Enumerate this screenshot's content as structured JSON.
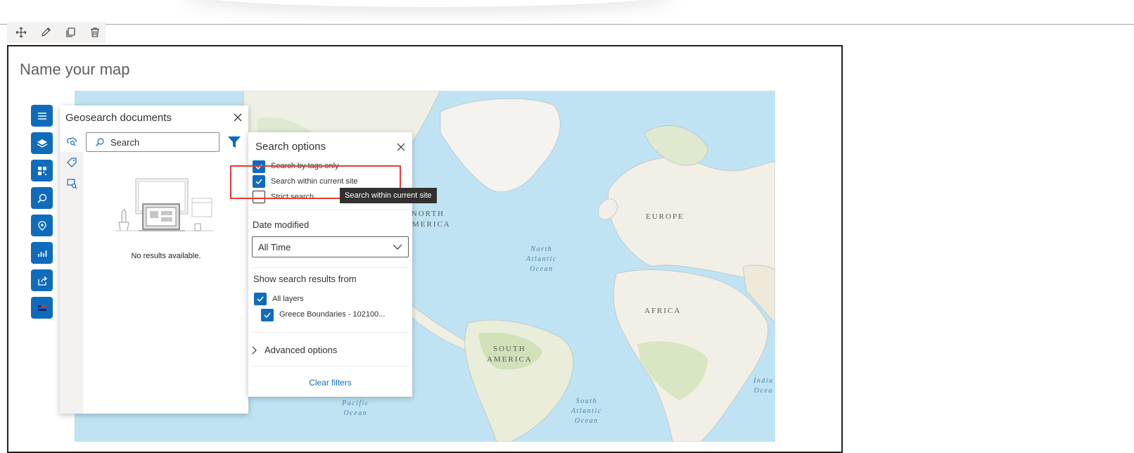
{
  "map_title": "Name your map",
  "map_labels": {
    "north_america": [
      "NORTH",
      "AMERICA"
    ],
    "europe": "EUROPE",
    "africa": "AFRICA",
    "south_america": [
      "SOUTH",
      "AMERICA"
    ],
    "north_atlantic": [
      "North",
      "Atlantic",
      "Ocean"
    ],
    "south_atlantic": [
      "South",
      "Atlantic",
      "Ocean"
    ],
    "pacific": [
      "Pacific",
      "Ocean"
    ],
    "indian": [
      "India",
      "Ocea"
    ]
  },
  "rail_icons": [
    "menu-icon",
    "layers-icon",
    "qr-icon",
    "search-icon",
    "geosearch-icon",
    "analytics-icon",
    "share-icon",
    "legend-icon"
  ],
  "panel": {
    "title": "Geosearch documents",
    "search_placeholder": "Search",
    "no_results": "No results available."
  },
  "search_options": {
    "title": "Search options",
    "checkboxes": [
      {
        "label": "Search by tags only",
        "checked": true
      },
      {
        "label": "Search within current site",
        "checked": true
      },
      {
        "label": "Strict search",
        "checked": false
      }
    ],
    "date_modified_label": "Date modified",
    "date_modified_value": "All Time",
    "show_results_label": "Show search results from",
    "layers": [
      {
        "label": "All layers",
        "checked": true
      },
      {
        "label": "Greece Boundaries - 102100...",
        "checked": true
      }
    ],
    "advanced_label": "Advanced options",
    "clear_label": "Clear filters"
  },
  "tooltip": "Search within current site",
  "colors": {
    "accent": "#0f6cbd",
    "highlight": "#e03c3c",
    "ocean": "#bfe3f3",
    "land": "#f2efe6"
  }
}
